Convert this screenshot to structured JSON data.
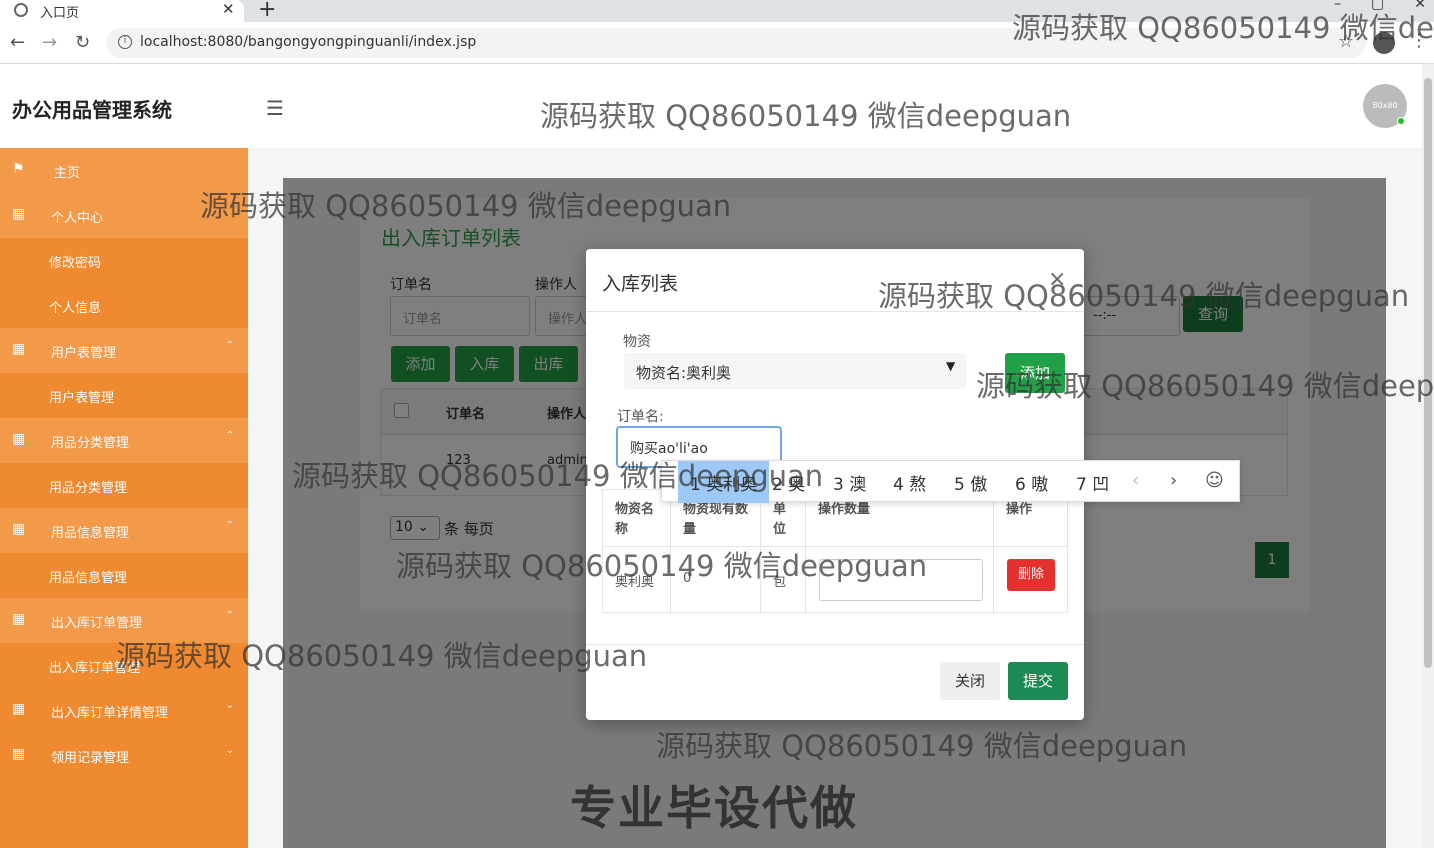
{
  "browser": {
    "tab_title": "入口页",
    "url": "localhost:8080/bangongyongpinguanli/index.jsp"
  },
  "app": {
    "title": "办公用品管理系统",
    "avatar_text": "80x80"
  },
  "sidebar": {
    "items": [
      {
        "label": "主页",
        "icon": "flag-icon"
      },
      {
        "label": "个人中心",
        "icon": "grid-icon"
      },
      {
        "label": "修改密码"
      },
      {
        "label": "个人信息"
      },
      {
        "label": "用户表管理",
        "icon": "grid-icon"
      },
      {
        "label": "用户表管理"
      },
      {
        "label": "用品分类管理",
        "icon": "grid-icon"
      },
      {
        "label": "用品分类管理"
      },
      {
        "label": "用品信息管理",
        "icon": "grid-icon"
      },
      {
        "label": "用品信息管理"
      },
      {
        "label": "出入库订单管理",
        "icon": "grid-icon"
      },
      {
        "label": "出入库订单管理"
      },
      {
        "label": "出入库订单详情管理",
        "icon": "grid-icon"
      },
      {
        "label": "领用记录管理",
        "icon": "grid-icon"
      }
    ]
  },
  "page": {
    "title": "出入库订单列表",
    "filters": {
      "order_name_label": "订单名",
      "order_name_placeholder": "订单名",
      "operator_label": "操作人",
      "operator_placeholder": "操作人",
      "date_value": "--:--",
      "query_button": "查询"
    },
    "toolbar": {
      "add": "添加",
      "inbound": "入库",
      "outbound": "出库"
    },
    "table": {
      "headers": [
        "订单名",
        "操作人"
      ],
      "rows": [
        {
          "name": "123",
          "operator": "admin"
        }
      ]
    },
    "pagination": {
      "page_size": "10",
      "page_size_label": "条 每页",
      "current_page": "1"
    }
  },
  "modal": {
    "title": "入库列表",
    "material_label": "物资",
    "material_value": "物资名:奥利奥",
    "add_button": "添加",
    "order_name_label": "订单名:",
    "order_name_value": "购买ao'li'ao",
    "table": {
      "headers": [
        "物资名称",
        "物资现有数量",
        "单位",
        "操作数量",
        "操作"
      ],
      "row": {
        "name": "奥利奥",
        "stock": "0",
        "unit": "包",
        "delete": "删除"
      }
    },
    "close_button": "关闭",
    "submit_button": "提交"
  },
  "ime": {
    "candidates": [
      "1 奥利奥",
      "2 奥",
      "3 澳",
      "4 熬",
      "5 傲",
      "6 嗷",
      "7 凹"
    ]
  },
  "watermarks": {
    "text": "源码获取 QQ86050149 微信deepguan",
    "banner": "专业毕设代做"
  }
}
